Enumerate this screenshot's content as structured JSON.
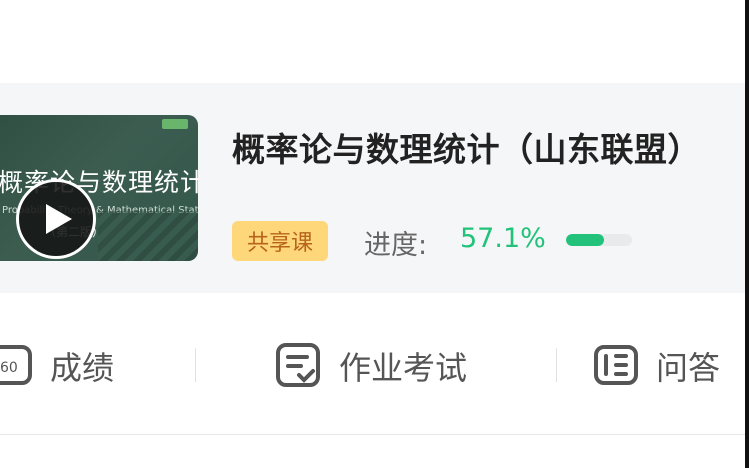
{
  "course": {
    "title": "概率论与数理统计（山东联盟）",
    "tag": "共享课",
    "progress_label": "进度:",
    "progress_value": "57.1%",
    "progress_fraction": 0.571,
    "cover": {
      "title": "概率论与数理统计",
      "subtitle": "Probability Theory & Mathematical Statistics",
      "edition": "（第二版）"
    }
  },
  "actions": {
    "grades": "成绩",
    "homework_exam": "作业考试",
    "qa": "问答"
  },
  "colors": {
    "accent_green": "#22c27a",
    "tag_bg": "#fdd77a",
    "tag_text": "#b8641b"
  }
}
